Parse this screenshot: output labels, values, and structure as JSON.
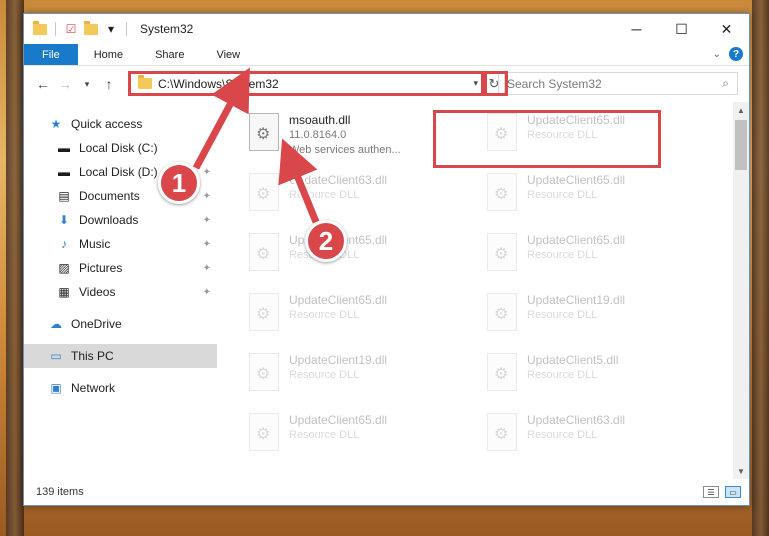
{
  "window": {
    "title": "System32",
    "controls": {
      "minimize": "─",
      "maximize": "☐",
      "close": "✕"
    }
  },
  "ribbon": {
    "tabs": [
      "File",
      "Home",
      "Share",
      "View"
    ],
    "help": "?"
  },
  "navigation": {
    "address": "C:\\Windows\\System32",
    "search_placeholder": "Search System32"
  },
  "sidebar": {
    "items": [
      {
        "label": "Quick access",
        "icon": "star-icon",
        "pinned": false
      },
      {
        "label": "Local Disk (C:)",
        "icon": "drive-icon",
        "pinned": true
      },
      {
        "label": "Local Disk (D:)",
        "icon": "drive-icon",
        "pinned": true
      },
      {
        "label": "Documents",
        "icon": "documents-icon",
        "pinned": true
      },
      {
        "label": "Downloads",
        "icon": "download-icon",
        "pinned": true
      },
      {
        "label": "Music",
        "icon": "music-icon",
        "pinned": true
      },
      {
        "label": "Pictures",
        "icon": "pictures-icon",
        "pinned": true
      },
      {
        "label": "Videos",
        "icon": "videos-icon",
        "pinned": true
      },
      {
        "label": "OneDrive",
        "icon": "cloud-icon"
      },
      {
        "label": "This PC",
        "icon": "computer-icon",
        "selected": true
      },
      {
        "label": "Network",
        "icon": "network-icon"
      }
    ]
  },
  "files": [
    {
      "name": "msoauth.dll",
      "version": "11.0.8164.0",
      "desc": "Web services authen..."
    },
    {
      "name": "UpdateClient65.dll",
      "desc": "Resource DLL"
    },
    {
      "name": "UpdateClient63.dll",
      "desc": "Resource DLL"
    },
    {
      "name": "UpdateClient65.dll",
      "desc": "Resource DLL"
    },
    {
      "name": "UpdateClient65.dll",
      "desc": "Resource DLL"
    },
    {
      "name": "UpdateClient65.dll",
      "desc": "Resource DLL"
    },
    {
      "name": "UpdateClient65.dll",
      "desc": "Resource DLL"
    },
    {
      "name": "UpdateClient19.dll",
      "desc": "Resource DLL"
    },
    {
      "name": "UpdateClient19.dll",
      "desc": "Resource DLL"
    },
    {
      "name": "UpdateClient5.dll",
      "desc": "Resource DLL"
    },
    {
      "name": "UpdateClient65.dll",
      "desc": "Resource DLL"
    },
    {
      "name": "UpdateClient63.dll",
      "desc": "Resource DLL"
    }
  ],
  "status": {
    "item_count": "139 items"
  },
  "annotations": {
    "badge1": "1",
    "badge2": "2",
    "highlight_color": "#d9474b"
  }
}
